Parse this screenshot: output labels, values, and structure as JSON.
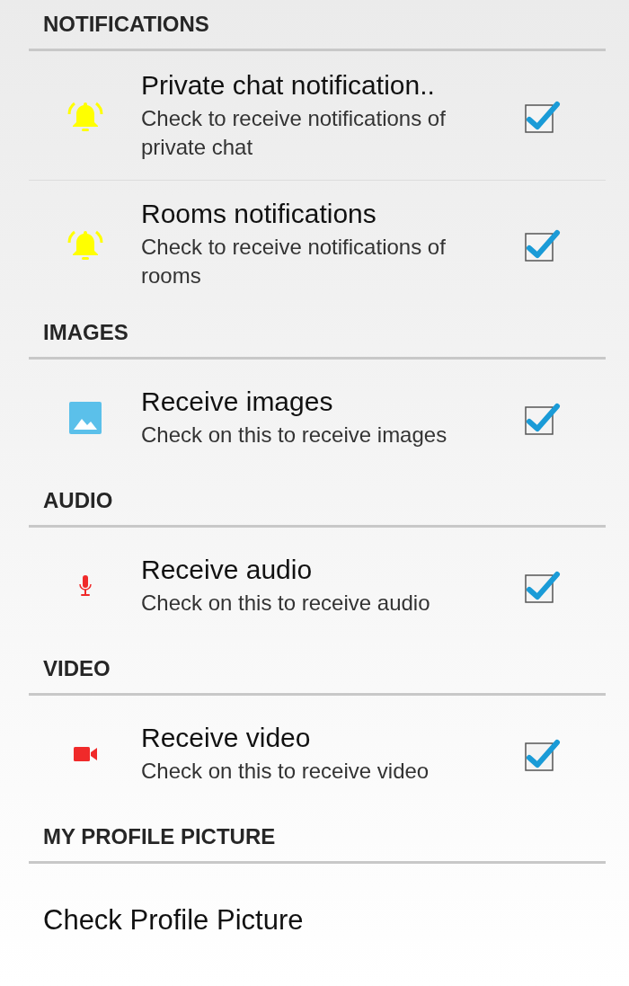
{
  "sections": [
    {
      "title": "NOTIFICATIONS",
      "items": [
        {
          "kind": "checkbox",
          "title": "Private chat notification..",
          "summary": "Check to receive notifications of private chat",
          "checked": true
        },
        {
          "kind": "checkbox",
          "title": "Rooms notifications",
          "summary": "Check to receive notifications of rooms",
          "checked": true
        }
      ]
    },
    {
      "title": "IMAGES",
      "items": [
        {
          "kind": "checkbox",
          "title": "Receive images",
          "summary": "Check on this to receive images",
          "checked": true
        }
      ]
    },
    {
      "title": "AUDIO",
      "items": [
        {
          "kind": "checkbox",
          "title": "Receive audio",
          "summary": "Check on this to receive audio",
          "checked": true
        }
      ]
    },
    {
      "title": "VIDEO",
      "items": [
        {
          "kind": "checkbox",
          "title": "Receive video",
          "summary": "Check on this to receive video",
          "checked": true
        }
      ]
    },
    {
      "title": "MY PROFILE PICTURE",
      "items": [
        {
          "kind": "plain",
          "title": "Check Profile Picture"
        }
      ]
    }
  ]
}
